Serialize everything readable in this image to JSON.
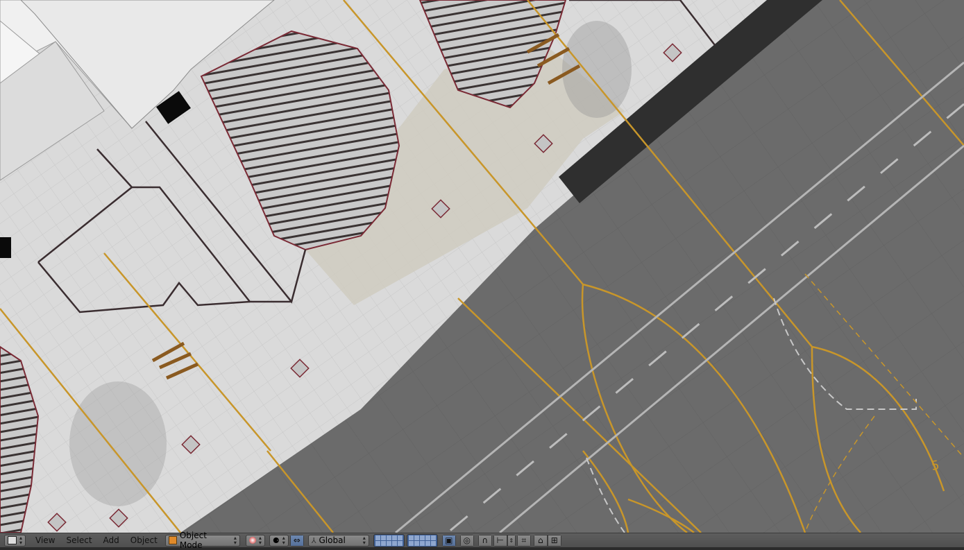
{
  "header": {
    "editor_type_icon": "cube-view-icon",
    "menus": [
      "View",
      "Select",
      "Add",
      "Object"
    ],
    "mode": "Object Mode",
    "mode_icon": "object-mode-cube-icon",
    "shading_icon": "solid-sphere-icon",
    "pivot_icon": "pivot-point-icon",
    "manipulator_icon": "manipulator-arrows-icon",
    "orientation": "Global",
    "orientation_icon": "transform-axes-icon",
    "layer_blocks": 2,
    "extra_icons": [
      "lock-camera-icon",
      "proportional-edit-icon",
      "snap-icon",
      "snap-element-icon",
      "snap-target-icon",
      "render-camera-icon",
      "render-clapper-icon"
    ]
  },
  "viewport": {
    "description_free": true,
    "runway_number": "5"
  },
  "colors": {
    "accent_blue": "#5a7ab0",
    "taxi_line": "#c8962a",
    "hatch_red": "#8a2b3a"
  }
}
